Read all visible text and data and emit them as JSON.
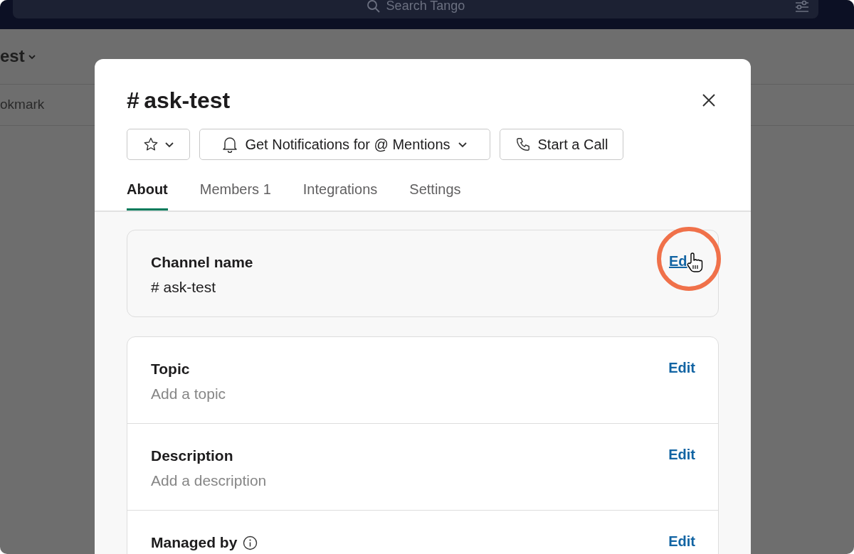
{
  "background": {
    "search_placeholder": "Search Tango",
    "channel_header": "est",
    "bookmark_label": "okmark"
  },
  "dialog": {
    "title": "ask-test",
    "title_prefix": "#",
    "star_button": {
      "starred": false
    },
    "notifications_button": {
      "label": "Get Notifications for @ Mentions"
    },
    "call_button": {
      "label": "Start a Call"
    },
    "tabs": [
      {
        "label": "About",
        "selected": true
      },
      {
        "label": "Members",
        "count": "1",
        "selected": false
      },
      {
        "label": "Integrations",
        "selected": false
      },
      {
        "label": "Settings",
        "selected": false
      }
    ],
    "channel_name": {
      "label": "Channel name",
      "value": "# ask-test",
      "action": "Ed",
      "highlighted": true
    },
    "sections": [
      {
        "label": "Topic",
        "value": "Add a topic",
        "action": "Edit"
      },
      {
        "label": "Description",
        "value": "Add a description",
        "action": "Edit"
      },
      {
        "label": "Managed by",
        "info": true,
        "action": "Edit"
      }
    ]
  }
}
